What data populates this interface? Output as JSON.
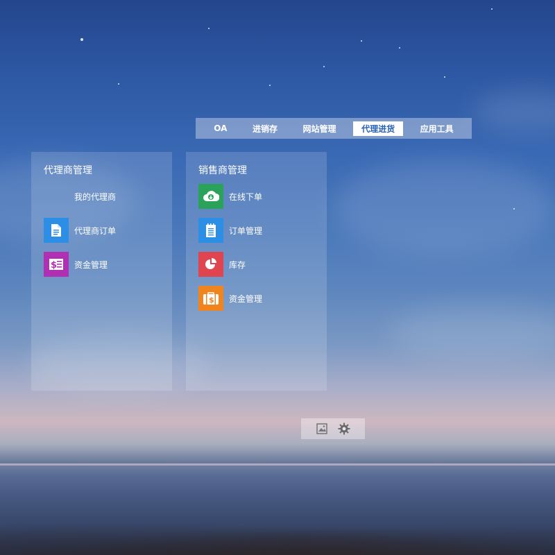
{
  "nav": {
    "tabs": [
      {
        "label": "OA",
        "active": false
      },
      {
        "label": "进销存",
        "active": false
      },
      {
        "label": "网站管理",
        "active": false
      },
      {
        "label": "代理进货",
        "active": true
      },
      {
        "label": "应用工具",
        "active": false
      }
    ]
  },
  "panels": {
    "agent": {
      "title": "代理商管理",
      "items": [
        {
          "label": "我的代理商",
          "icon": "none",
          "color": ""
        },
        {
          "label": "代理商订单",
          "icon": "document-icon",
          "color": "#2d8ee6"
        },
        {
          "label": "资金管理",
          "icon": "receipt-dollar-icon",
          "color": "#b02fb2"
        }
      ]
    },
    "sales": {
      "title": "销售商管理",
      "items": [
        {
          "label": "在线下单",
          "icon": "cloud-download-icon",
          "color": "#2aa25a"
        },
        {
          "label": "订单管理",
          "icon": "notepad-icon",
          "color": "#2d8ee6"
        },
        {
          "label": "库存",
          "icon": "pie-chart-icon",
          "color": "#e0454f"
        },
        {
          "label": "资金管理",
          "icon": "wallet-dollar-icon",
          "color": "#f0841e"
        }
      ]
    }
  },
  "bottom_bar": {
    "icons": [
      "picture-icon",
      "gear-icon"
    ]
  }
}
